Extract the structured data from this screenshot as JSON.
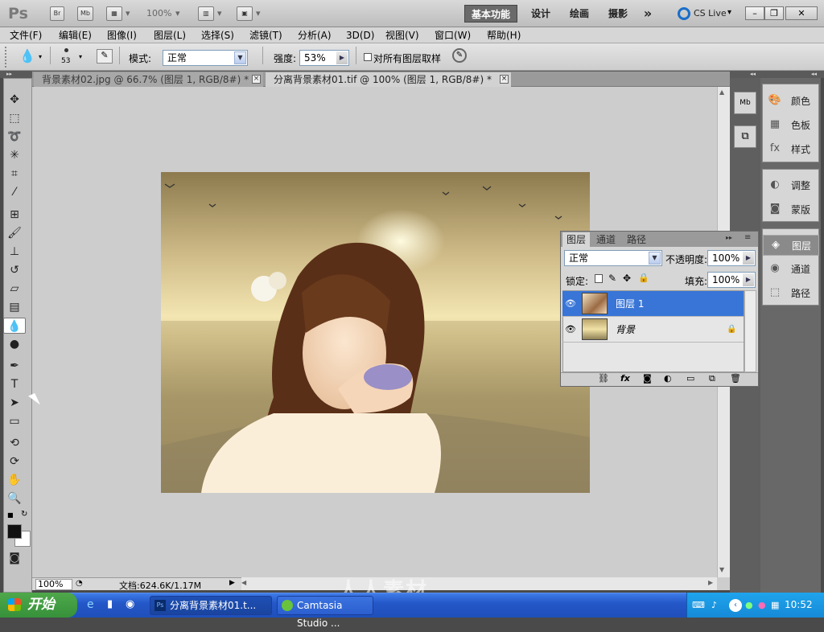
{
  "app": {
    "logo": "Ps",
    "bridge_label": "Br",
    "minibridge_label": "Mb",
    "zoom": "100%",
    "workspaces": [
      "基本功能",
      "设计",
      "绘画",
      "摄影"
    ],
    "more_glyph": "»",
    "cslive": "CS Live",
    "window_buttons": [
      "–",
      "❐",
      "✕"
    ]
  },
  "menu": [
    "文件(F)",
    "编辑(E)",
    "图像(I)",
    "图层(L)",
    "选择(S)",
    "滤镜(T)",
    "分析(A)",
    "3D(D)",
    "视图(V)",
    "窗口(W)",
    "帮助(H)"
  ],
  "options": {
    "brush_size": "53",
    "mode_label": "模式:",
    "mode_value": "正常",
    "strength_label": "强度:",
    "strength_value": "53%",
    "sample_all_label": "对所有图层取样",
    "sample_all_checked": false
  },
  "tabs": [
    {
      "label": "背景素材02.jpg @ 66.7% (图层 1, RGB/8#) *",
      "active": false
    },
    {
      "label": "分离背景素材01.tif @ 100% (图层 1, RGB/8#) *",
      "active": true
    }
  ],
  "status": {
    "zoom": "100%",
    "doc": "文档:624.6K/1.17M"
  },
  "right_dock": {
    "group1": [
      "颜色",
      "色板",
      "样式"
    ],
    "group2": [
      "调整",
      "蒙版"
    ],
    "group3": [
      "图层",
      "通道",
      "路径"
    ],
    "active": "图层"
  },
  "layers_panel": {
    "tabs": [
      "图层",
      "通道",
      "路径"
    ],
    "blend_mode": "正常",
    "opacity_label": "不透明度:",
    "opacity_value": "100%",
    "lock_label": "锁定:",
    "fill_label": "填充:",
    "fill_value": "100%",
    "layers": [
      {
        "name": "图层 1",
        "selected": true
      },
      {
        "name": "背景",
        "selected": false,
        "locked": true
      }
    ]
  },
  "taskbar": {
    "start": "开始",
    "tasks": [
      "分离背景素材01.t...",
      "Camtasia Studio ..."
    ],
    "clock": "10:52"
  },
  "watermark": "人人素材",
  "colors": {
    "accent": "#3875d7",
    "taskbar": "#2457c8",
    "start": "#36913a"
  }
}
